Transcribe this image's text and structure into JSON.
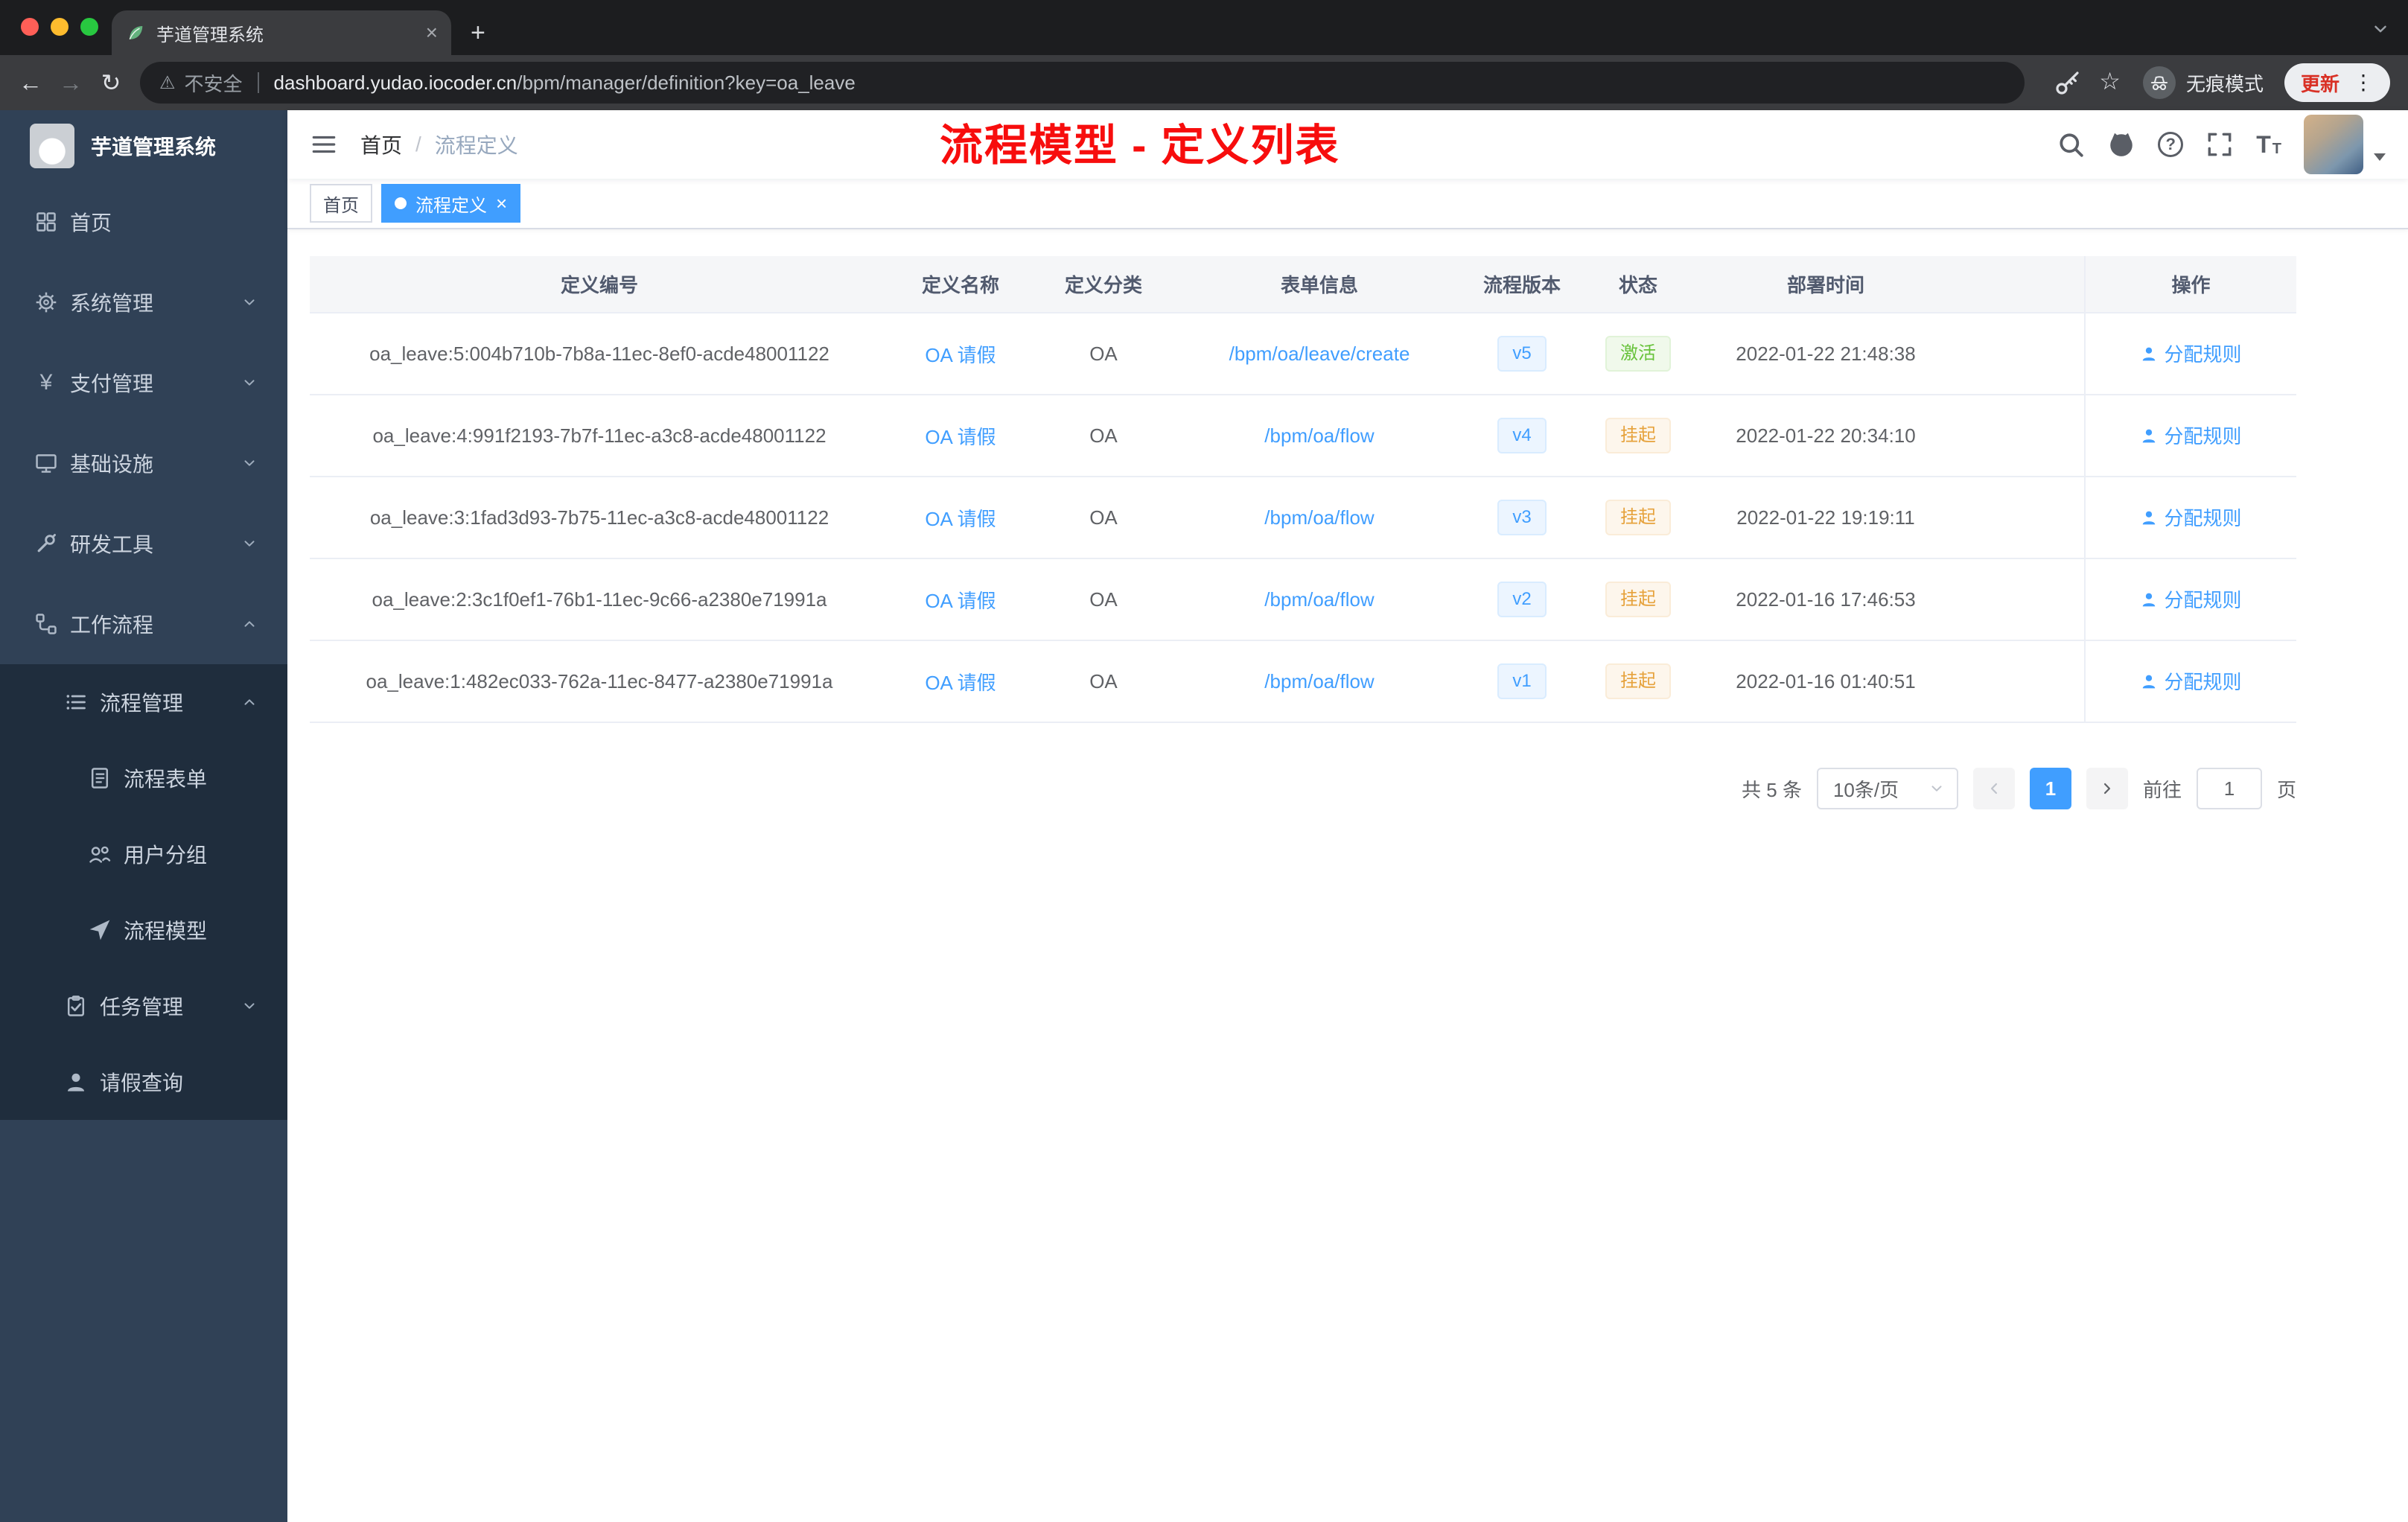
{
  "colors": {
    "accent": "#409eff",
    "sidebar_bg": "#304156",
    "submenu_bg": "#1f2d3d",
    "success": "#67c23a",
    "warning": "#e6a23c",
    "annotation_red": "#f70d0d"
  },
  "glyphs": {
    "close": "×",
    "plus": "+",
    "back": "←",
    "forward": "→",
    "reload": "↻",
    "star": "☆",
    "warning": "⚠",
    "dots": "⋮",
    "yen": "¥"
  },
  "browser": {
    "tab_title": "芋道管理系统",
    "not_secure": "不安全",
    "url_host": "dashboard.yudao.iocoder.cn",
    "url_path": "/bpm/manager/definition?key=oa_leave",
    "incognito_label": "无痕模式",
    "update_label": "更新"
  },
  "sidebar": {
    "logo_title": "芋道管理系统",
    "items": [
      {
        "label": "首页",
        "icon": "grid",
        "depth": 0
      },
      {
        "label": "系统管理",
        "icon": "gear",
        "depth": 0,
        "arrow": "down"
      },
      {
        "label": "支付管理",
        "icon": "yen",
        "depth": 0,
        "arrow": "down"
      },
      {
        "label": "基础设施",
        "icon": "monitor",
        "depth": 0,
        "arrow": "down"
      },
      {
        "label": "研发工具",
        "icon": "tools",
        "depth": 0,
        "arrow": "down"
      },
      {
        "label": "工作流程",
        "icon": "workflow",
        "depth": 0,
        "arrow": "up"
      },
      {
        "label": "流程管理",
        "icon": "list",
        "depth": 1,
        "arrow": "up",
        "sub": true
      },
      {
        "label": "流程表单",
        "icon": "form",
        "depth": 2,
        "sub": true
      },
      {
        "label": "用户分组",
        "icon": "users",
        "depth": 2,
        "sub": true
      },
      {
        "label": "流程模型",
        "icon": "send",
        "depth": 2,
        "sub": true
      },
      {
        "label": "任务管理",
        "icon": "task",
        "depth": 1,
        "arrow": "down",
        "sub": true
      },
      {
        "label": "请假查询",
        "icon": "person",
        "depth": 1,
        "sub": true
      }
    ]
  },
  "header": {
    "breadcrumb": [
      "首页",
      "流程定义"
    ],
    "breadcrumb_separator": "/",
    "annotation": "流程模型 - 定义列表"
  },
  "tags": [
    {
      "label": "首页",
      "active": false
    },
    {
      "label": "流程定义",
      "active": true
    }
  ],
  "table": {
    "columns": [
      "定义编号",
      "定义名称",
      "定义分类",
      "表单信息",
      "流程版本",
      "状态",
      "部署时间",
      "操作"
    ],
    "rows": [
      {
        "id": "oa_leave:5:004b710b-7b8a-11ec-8ef0-acde48001122",
        "name": "OA 请假",
        "category": "OA",
        "form": "/bpm/oa/leave/create",
        "version": "v5",
        "status": {
          "label": "激活",
          "type": "success"
        },
        "time": "2022-01-22 21:48:38",
        "action": "分配规则"
      },
      {
        "id": "oa_leave:4:991f2193-7b7f-11ec-a3c8-acde48001122",
        "name": "OA 请假",
        "category": "OA",
        "form": "/bpm/oa/flow",
        "version": "v4",
        "status": {
          "label": "挂起",
          "type": "warning"
        },
        "time": "2022-01-22 20:34:10",
        "action": "分配规则"
      },
      {
        "id": "oa_leave:3:1fad3d93-7b75-11ec-a3c8-acde48001122",
        "name": "OA 请假",
        "category": "OA",
        "form": "/bpm/oa/flow",
        "version": "v3",
        "status": {
          "label": "挂起",
          "type": "warning"
        },
        "time": "2022-01-22 19:19:11",
        "action": "分配规则"
      },
      {
        "id": "oa_leave:2:3c1f0ef1-76b1-11ec-9c66-a2380e71991a",
        "name": "OA 请假",
        "category": "OA",
        "form": "/bpm/oa/flow",
        "version": "v2",
        "status": {
          "label": "挂起",
          "type": "warning"
        },
        "time": "2022-01-16 17:46:53",
        "action": "分配规则"
      },
      {
        "id": "oa_leave:1:482ec033-762a-11ec-8477-a2380e71991a",
        "name": "OA 请假",
        "category": "OA",
        "form": "/bpm/oa/flow",
        "version": "v1",
        "status": {
          "label": "挂起",
          "type": "warning"
        },
        "time": "2022-01-16 01:40:51",
        "action": "分配规则"
      }
    ]
  },
  "pagination": {
    "total": "共 5 条",
    "page_size": "10条/页",
    "current_page": "1",
    "goto_label": "前往",
    "goto_value": "1",
    "page_unit": "页"
  }
}
